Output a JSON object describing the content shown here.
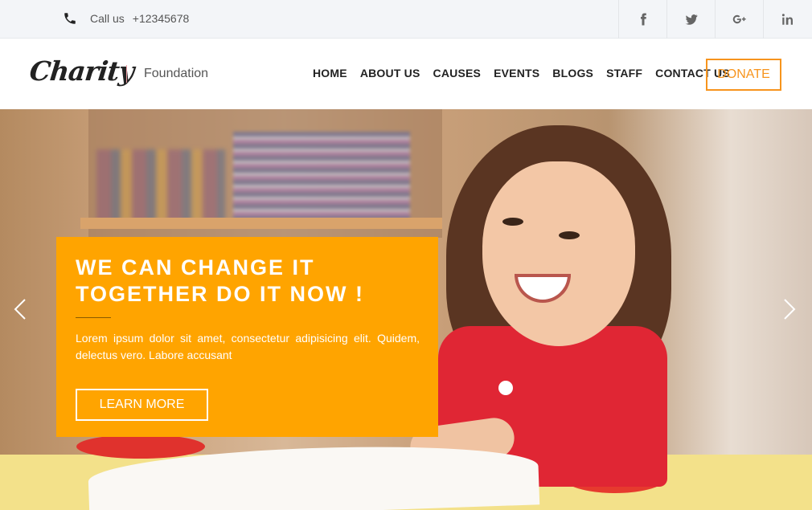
{
  "topbar": {
    "call_label": "Call us",
    "phone_number": "+12345678",
    "socials": [
      "facebook-icon",
      "twitter-icon",
      "google-plus-icon",
      "linkedin-icon"
    ]
  },
  "header": {
    "logo": "Charity",
    "tagline": "Foundation",
    "nav": [
      "HOME",
      "ABOUT US",
      "CAUSES",
      "EVENTS",
      "BLOGS",
      "STAFF",
      "CONTACT US"
    ],
    "donate_label": "DONATE"
  },
  "hero": {
    "title": "WE CAN CHANGE IT TOGETHER DO IT NOW !",
    "text": "Lorem ipsum dolor sit amet, consectetur adipisicing elit. Quidem, delectus vero. Labore accusant",
    "button_label": "LEARN MORE"
  },
  "colors": {
    "accent": "#ffa400",
    "donate_border": "#f7941d",
    "topbar_bg": "#f3f5f8"
  }
}
